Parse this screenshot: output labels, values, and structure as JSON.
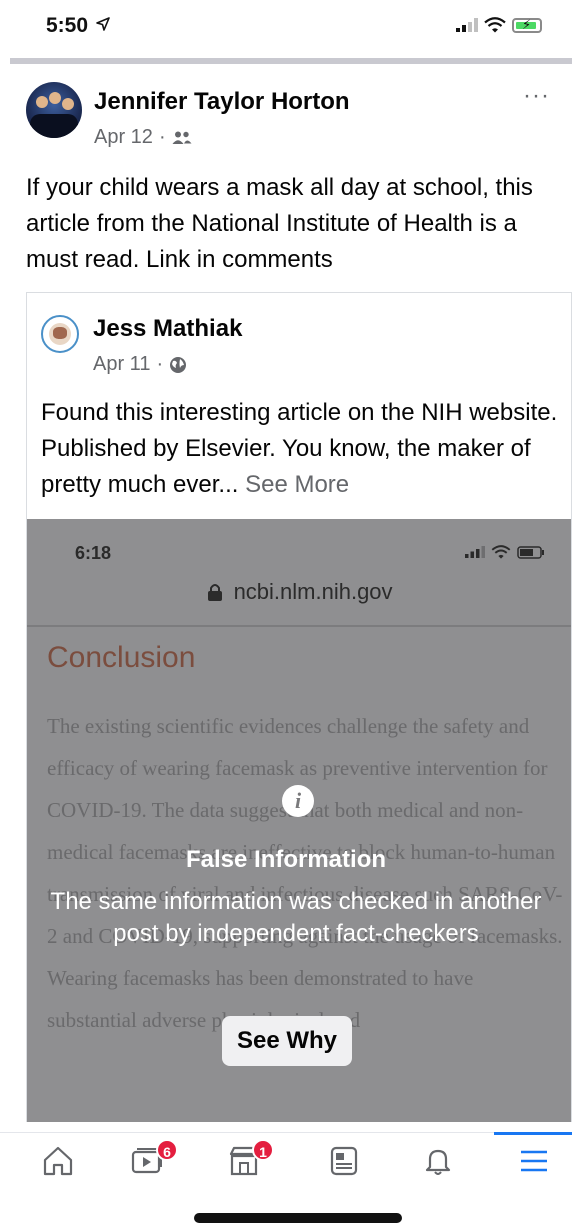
{
  "status_bar": {
    "time": "5:50"
  },
  "post": {
    "author": "Jennifer Taylor Horton",
    "date": "Apr 12",
    "audience_icon": "friends-icon",
    "text": "If your child wears a mask all day at  school, this article from the National Institute of Health is a must read. Link in comments",
    "more_icon": "more-dots-icon"
  },
  "shared_post": {
    "author": "Jess Mathiak",
    "date": "Apr 11",
    "audience_icon": "globe-icon",
    "text": "Found this interesting article on the NIH website. Published by Elsevier. You know, the maker of pretty much ever...",
    "see_more": "See More",
    "embedded": {
      "time": "6:18",
      "url": "ncbi.nlm.nih.gov",
      "heading": "Conclusion",
      "body": "The existing scientific evidences challenge the safety and efficacy of wearing facemask as preventive intervention for COVID-19. The data suggest that both medical and non-medical facemasks are ineffective to block human-to-human transmission of viral and infectious disease such SARS-CoV-2 and COVID-19, supporting against the usage of facemasks. Wearing facemasks has been demonstrated to have substantial adverse physiological and"
    }
  },
  "fact_check": {
    "title": "False Information",
    "description": "The same information was checked in another post by independent fact-checkers",
    "button": "See Why"
  },
  "bottom_nav": {
    "items": [
      {
        "name": "home",
        "icon": "home-icon",
        "badge": ""
      },
      {
        "name": "watch",
        "icon": "video-icon",
        "badge": "6"
      },
      {
        "name": "marketplace",
        "icon": "shop-icon",
        "badge": "1"
      },
      {
        "name": "news",
        "icon": "news-icon",
        "badge": ""
      },
      {
        "name": "notifications",
        "icon": "bell-icon",
        "badge": ""
      },
      {
        "name": "menu",
        "icon": "menu-icon",
        "badge": ""
      }
    ]
  },
  "colors": {
    "accent": "#1877f2",
    "badge": "#e41e3f",
    "meta_gray": "#65676b",
    "battery": "#4cd964"
  }
}
